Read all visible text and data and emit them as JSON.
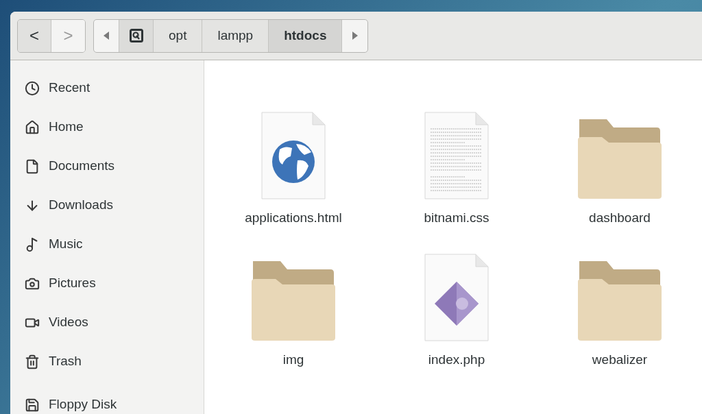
{
  "navigation": {
    "back": {
      "label": "<",
      "disabled": false
    },
    "forward": {
      "label": ">",
      "disabled": true
    }
  },
  "path_bar": {
    "scroll_left": {
      "disabled": false
    },
    "scroll_right": {
      "disabled": false
    },
    "crumbs": [
      {
        "kind": "drive",
        "selected": false
      },
      {
        "kind": "folder",
        "label": "opt",
        "selected": false
      },
      {
        "kind": "folder",
        "label": "lampp",
        "selected": false
      },
      {
        "kind": "folder",
        "label": "htdocs",
        "selected": true
      }
    ]
  },
  "sidebar": {
    "places": [
      {
        "label": "Recent"
      },
      {
        "label": "Home"
      },
      {
        "label": "Documents"
      },
      {
        "label": "Downloads"
      },
      {
        "label": "Music"
      },
      {
        "label": "Pictures"
      },
      {
        "label": "Videos"
      },
      {
        "label": "Trash"
      }
    ],
    "devices": [
      {
        "label": "Floppy Disk"
      }
    ]
  },
  "files": [
    {
      "name": "applications.html",
      "kind": "html"
    },
    {
      "name": "bitnami.css",
      "kind": "text"
    },
    {
      "name": "dashboard",
      "kind": "folder"
    },
    {
      "name": "img",
      "kind": "folder"
    },
    {
      "name": "index.php",
      "kind": "php"
    },
    {
      "name": "webalizer",
      "kind": "folder"
    }
  ]
}
